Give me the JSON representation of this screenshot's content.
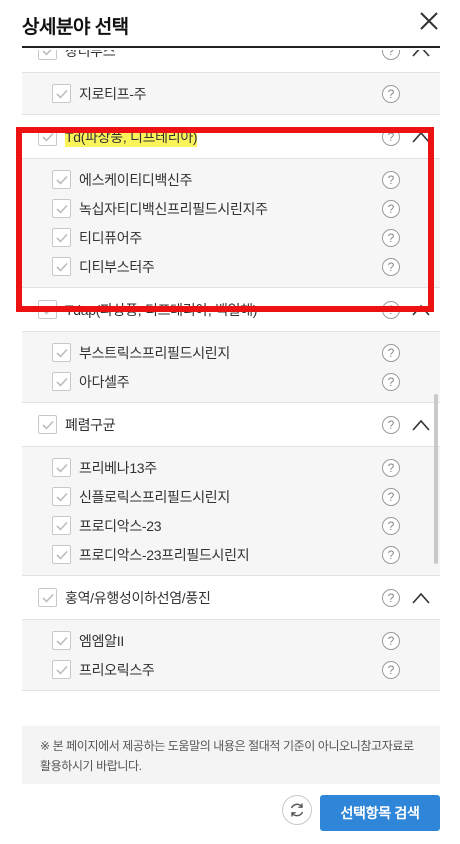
{
  "header": {
    "title": "상세분야 선택"
  },
  "groups": [
    {
      "label": "장티푸스",
      "children": [
        "지로티프-주"
      ]
    },
    {
      "label": "Td(파상풍, 디프테리아)",
      "children": [
        "에스케이티디백신주",
        "녹십자티디백신프리필드시린지주",
        "티디퓨어주",
        "디티부스터주"
      ]
    },
    {
      "label": "Tdap(파상풍, 디프테리아, 백일해)",
      "children": [
        "부스트릭스프리필드시린지",
        "아다셀주"
      ]
    },
    {
      "label": "폐렴구균",
      "children": [
        "프리베나13주",
        "신플로릭스프리필드시린지",
        "프로디악스-23",
        "프로디악스-23프리필드시린지"
      ]
    },
    {
      "label": "홍역/유행성이하선염/풍진",
      "children": [
        "엠엠알II",
        "프리오릭스주"
      ]
    }
  ],
  "help_glyph": "?",
  "notice": "※ 본 페이지에서 제공하는 도움말의 내용은 절대적 기준이 아니오니참고자료로 활용하시기 바랍니다.",
  "search_button_label": "선택항목 검색",
  "colors": {
    "accent": "#2f86d8",
    "highlight": "#fbf35a",
    "annotation_box": "#ee1111"
  }
}
